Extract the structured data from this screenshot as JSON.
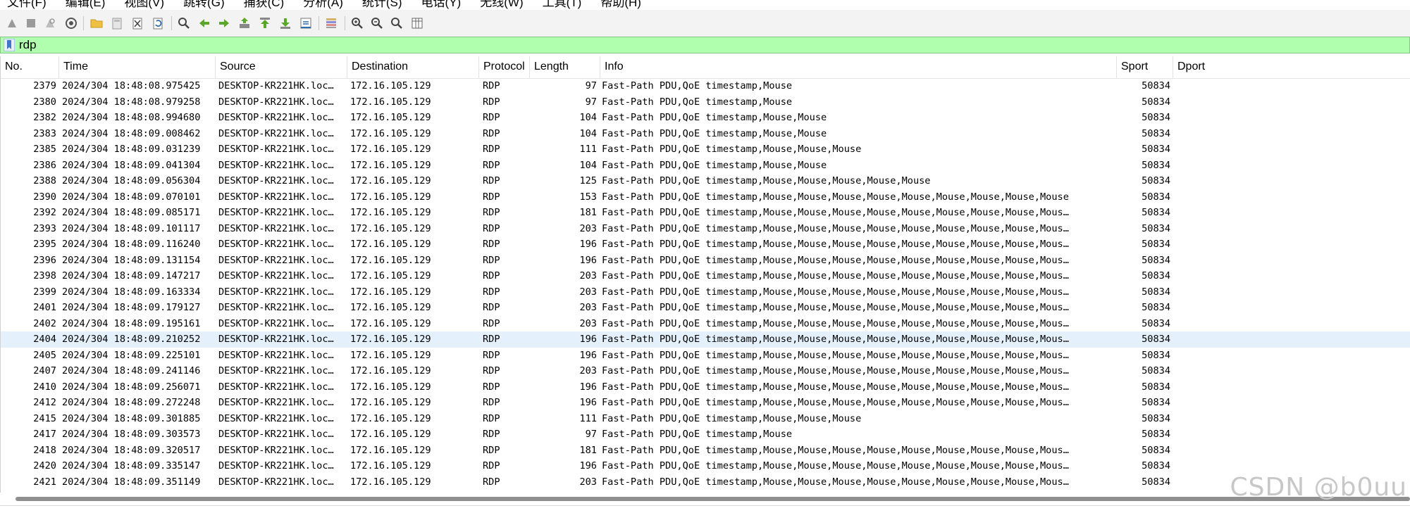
{
  "menu": [
    "文件(F)",
    "编辑(E)",
    "视图(V)",
    "跳转(G)",
    "捕获(C)",
    "分析(A)",
    "统计(S)",
    "电话(Y)",
    "无线(W)",
    "工具(T)",
    "帮助(H)"
  ],
  "toolbar": {
    "icons": [
      "start-capture-icon",
      "stop-capture-icon",
      "restart-capture-icon",
      "capture-options-icon",
      "open-file-icon",
      "save-file-icon",
      "close-file-icon",
      "reload-file-icon",
      "find-packet-icon",
      "go-back-icon",
      "go-forward-icon",
      "go-to-packet-icon",
      "first-packet-icon",
      "last-packet-icon",
      "autoscroll-icon",
      "colorize-icon",
      "zoom-in-icon",
      "zoom-out-icon",
      "normal-size-icon",
      "resize-columns-icon"
    ]
  },
  "filter": {
    "value": "rdp"
  },
  "columns": [
    "No.",
    "Time",
    "Source",
    "Destination",
    "Protocol",
    "Length",
    "Info",
    "Sport",
    "Dport"
  ],
  "selected_row_no": "2404",
  "rows": [
    {
      "no": "2379",
      "time": "2024/304 18:48:08.975425",
      "src": "DESKTOP-KR221HK.loc…",
      "dst": "172.16.105.129",
      "proto": "RDP",
      "len": "97",
      "info": "Fast-Path PDU,QoE timestamp,Mouse",
      "sport": "50834"
    },
    {
      "no": "2380",
      "time": "2024/304 18:48:08.979258",
      "src": "DESKTOP-KR221HK.loc…",
      "dst": "172.16.105.129",
      "proto": "RDP",
      "len": "97",
      "info": "Fast-Path PDU,QoE timestamp,Mouse",
      "sport": "50834"
    },
    {
      "no": "2382",
      "time": "2024/304 18:48:08.994680",
      "src": "DESKTOP-KR221HK.loc…",
      "dst": "172.16.105.129",
      "proto": "RDP",
      "len": "104",
      "info": "Fast-Path PDU,QoE timestamp,Mouse,Mouse",
      "sport": "50834"
    },
    {
      "no": "2383",
      "time": "2024/304 18:48:09.008462",
      "src": "DESKTOP-KR221HK.loc…",
      "dst": "172.16.105.129",
      "proto": "RDP",
      "len": "104",
      "info": "Fast-Path PDU,QoE timestamp,Mouse,Mouse",
      "sport": "50834"
    },
    {
      "no": "2385",
      "time": "2024/304 18:48:09.031239",
      "src": "DESKTOP-KR221HK.loc…",
      "dst": "172.16.105.129",
      "proto": "RDP",
      "len": "111",
      "info": "Fast-Path PDU,QoE timestamp,Mouse,Mouse,Mouse",
      "sport": "50834"
    },
    {
      "no": "2386",
      "time": "2024/304 18:48:09.041304",
      "src": "DESKTOP-KR221HK.loc…",
      "dst": "172.16.105.129",
      "proto": "RDP",
      "len": "104",
      "info": "Fast-Path PDU,QoE timestamp,Mouse,Mouse",
      "sport": "50834"
    },
    {
      "no": "2388",
      "time": "2024/304 18:48:09.056304",
      "src": "DESKTOP-KR221HK.loc…",
      "dst": "172.16.105.129",
      "proto": "RDP",
      "len": "125",
      "info": "Fast-Path PDU,QoE timestamp,Mouse,Mouse,Mouse,Mouse,Mouse",
      "sport": "50834"
    },
    {
      "no": "2390",
      "time": "2024/304 18:48:09.070101",
      "src": "DESKTOP-KR221HK.loc…",
      "dst": "172.16.105.129",
      "proto": "RDP",
      "len": "153",
      "info": "Fast-Path PDU,QoE timestamp,Mouse,Mouse,Mouse,Mouse,Mouse,Mouse,Mouse,Mouse,Mouse",
      "sport": "50834"
    },
    {
      "no": "2392",
      "time": "2024/304 18:48:09.085171",
      "src": "DESKTOP-KR221HK.loc…",
      "dst": "172.16.105.129",
      "proto": "RDP",
      "len": "181",
      "info": "Fast-Path PDU,QoE timestamp,Mouse,Mouse,Mouse,Mouse,Mouse,Mouse,Mouse,Mouse,Mous…",
      "sport": "50834"
    },
    {
      "no": "2393",
      "time": "2024/304 18:48:09.101117",
      "src": "DESKTOP-KR221HK.loc…",
      "dst": "172.16.105.129",
      "proto": "RDP",
      "len": "203",
      "info": "Fast-Path PDU,QoE timestamp,Mouse,Mouse,Mouse,Mouse,Mouse,Mouse,Mouse,Mouse,Mous…",
      "sport": "50834"
    },
    {
      "no": "2395",
      "time": "2024/304 18:48:09.116240",
      "src": "DESKTOP-KR221HK.loc…",
      "dst": "172.16.105.129",
      "proto": "RDP",
      "len": "196",
      "info": "Fast-Path PDU,QoE timestamp,Mouse,Mouse,Mouse,Mouse,Mouse,Mouse,Mouse,Mouse,Mous…",
      "sport": "50834"
    },
    {
      "no": "2396",
      "time": "2024/304 18:48:09.131154",
      "src": "DESKTOP-KR221HK.loc…",
      "dst": "172.16.105.129",
      "proto": "RDP",
      "len": "196",
      "info": "Fast-Path PDU,QoE timestamp,Mouse,Mouse,Mouse,Mouse,Mouse,Mouse,Mouse,Mouse,Mous…",
      "sport": "50834"
    },
    {
      "no": "2398",
      "time": "2024/304 18:48:09.147217",
      "src": "DESKTOP-KR221HK.loc…",
      "dst": "172.16.105.129",
      "proto": "RDP",
      "len": "203",
      "info": "Fast-Path PDU,QoE timestamp,Mouse,Mouse,Mouse,Mouse,Mouse,Mouse,Mouse,Mouse,Mous…",
      "sport": "50834"
    },
    {
      "no": "2399",
      "time": "2024/304 18:48:09.163334",
      "src": "DESKTOP-KR221HK.loc…",
      "dst": "172.16.105.129",
      "proto": "RDP",
      "len": "203",
      "info": "Fast-Path PDU,QoE timestamp,Mouse,Mouse,Mouse,Mouse,Mouse,Mouse,Mouse,Mouse,Mous…",
      "sport": "50834"
    },
    {
      "no": "2401",
      "time": "2024/304 18:48:09.179127",
      "src": "DESKTOP-KR221HK.loc…",
      "dst": "172.16.105.129",
      "proto": "RDP",
      "len": "203",
      "info": "Fast-Path PDU,QoE timestamp,Mouse,Mouse,Mouse,Mouse,Mouse,Mouse,Mouse,Mouse,Mous…",
      "sport": "50834"
    },
    {
      "no": "2402",
      "time": "2024/304 18:48:09.195161",
      "src": "DESKTOP-KR221HK.loc…",
      "dst": "172.16.105.129",
      "proto": "RDP",
      "len": "203",
      "info": "Fast-Path PDU,QoE timestamp,Mouse,Mouse,Mouse,Mouse,Mouse,Mouse,Mouse,Mouse,Mous…",
      "sport": "50834"
    },
    {
      "no": "2404",
      "time": "2024/304 18:48:09.210252",
      "src": "DESKTOP-KR221HK.loc…",
      "dst": "172.16.105.129",
      "proto": "RDP",
      "len": "196",
      "info": "Fast-Path PDU,QoE timestamp,Mouse,Mouse,Mouse,Mouse,Mouse,Mouse,Mouse,Mouse,Mous…",
      "sport": "50834"
    },
    {
      "no": "2405",
      "time": "2024/304 18:48:09.225101",
      "src": "DESKTOP-KR221HK.loc…",
      "dst": "172.16.105.129",
      "proto": "RDP",
      "len": "196",
      "info": "Fast-Path PDU,QoE timestamp,Mouse,Mouse,Mouse,Mouse,Mouse,Mouse,Mouse,Mouse,Mous…",
      "sport": "50834"
    },
    {
      "no": "2407",
      "time": "2024/304 18:48:09.241146",
      "src": "DESKTOP-KR221HK.loc…",
      "dst": "172.16.105.129",
      "proto": "RDP",
      "len": "203",
      "info": "Fast-Path PDU,QoE timestamp,Mouse,Mouse,Mouse,Mouse,Mouse,Mouse,Mouse,Mouse,Mous…",
      "sport": "50834"
    },
    {
      "no": "2410",
      "time": "2024/304 18:48:09.256071",
      "src": "DESKTOP-KR221HK.loc…",
      "dst": "172.16.105.129",
      "proto": "RDP",
      "len": "196",
      "info": "Fast-Path PDU,QoE timestamp,Mouse,Mouse,Mouse,Mouse,Mouse,Mouse,Mouse,Mouse,Mous…",
      "sport": "50834"
    },
    {
      "no": "2412",
      "time": "2024/304 18:48:09.272248",
      "src": "DESKTOP-KR221HK.loc…",
      "dst": "172.16.105.129",
      "proto": "RDP",
      "len": "196",
      "info": "Fast-Path PDU,QoE timestamp,Mouse,Mouse,Mouse,Mouse,Mouse,Mouse,Mouse,Mouse,Mous…",
      "sport": "50834"
    },
    {
      "no": "2415",
      "time": "2024/304 18:48:09.301885",
      "src": "DESKTOP-KR221HK.loc…",
      "dst": "172.16.105.129",
      "proto": "RDP",
      "len": "111",
      "info": "Fast-Path PDU,QoE timestamp,Mouse,Mouse,Mouse",
      "sport": "50834"
    },
    {
      "no": "2417",
      "time": "2024/304 18:48:09.303573",
      "src": "DESKTOP-KR221HK.loc…",
      "dst": "172.16.105.129",
      "proto": "RDP",
      "len": "97",
      "info": "Fast-Path PDU,QoE timestamp,Mouse",
      "sport": "50834"
    },
    {
      "no": "2418",
      "time": "2024/304 18:48:09.320517",
      "src": "DESKTOP-KR221HK.loc…",
      "dst": "172.16.105.129",
      "proto": "RDP",
      "len": "181",
      "info": "Fast-Path PDU,QoE timestamp,Mouse,Mouse,Mouse,Mouse,Mouse,Mouse,Mouse,Mouse,Mous…",
      "sport": "50834"
    },
    {
      "no": "2420",
      "time": "2024/304 18:48:09.335147",
      "src": "DESKTOP-KR221HK.loc…",
      "dst": "172.16.105.129",
      "proto": "RDP",
      "len": "196",
      "info": "Fast-Path PDU,QoE timestamp,Mouse,Mouse,Mouse,Mouse,Mouse,Mouse,Mouse,Mouse,Mous…",
      "sport": "50834"
    },
    {
      "no": "2421",
      "time": "2024/304 18:48:09.351149",
      "src": "DESKTOP-KR221HK.loc…",
      "dst": "172.16.105.129",
      "proto": "RDP",
      "len": "203",
      "info": "Fast-Path PDU,QoE timestamp,Mouse,Mouse,Mouse,Mouse,Mouse,Mouse,Mouse,Mouse,Mous…",
      "sport": "50834"
    }
  ],
  "watermark": "CSDN @b0uu",
  "colors": {
    "filter_valid": "#afffaf",
    "selected_row": "#e4f0fb"
  }
}
